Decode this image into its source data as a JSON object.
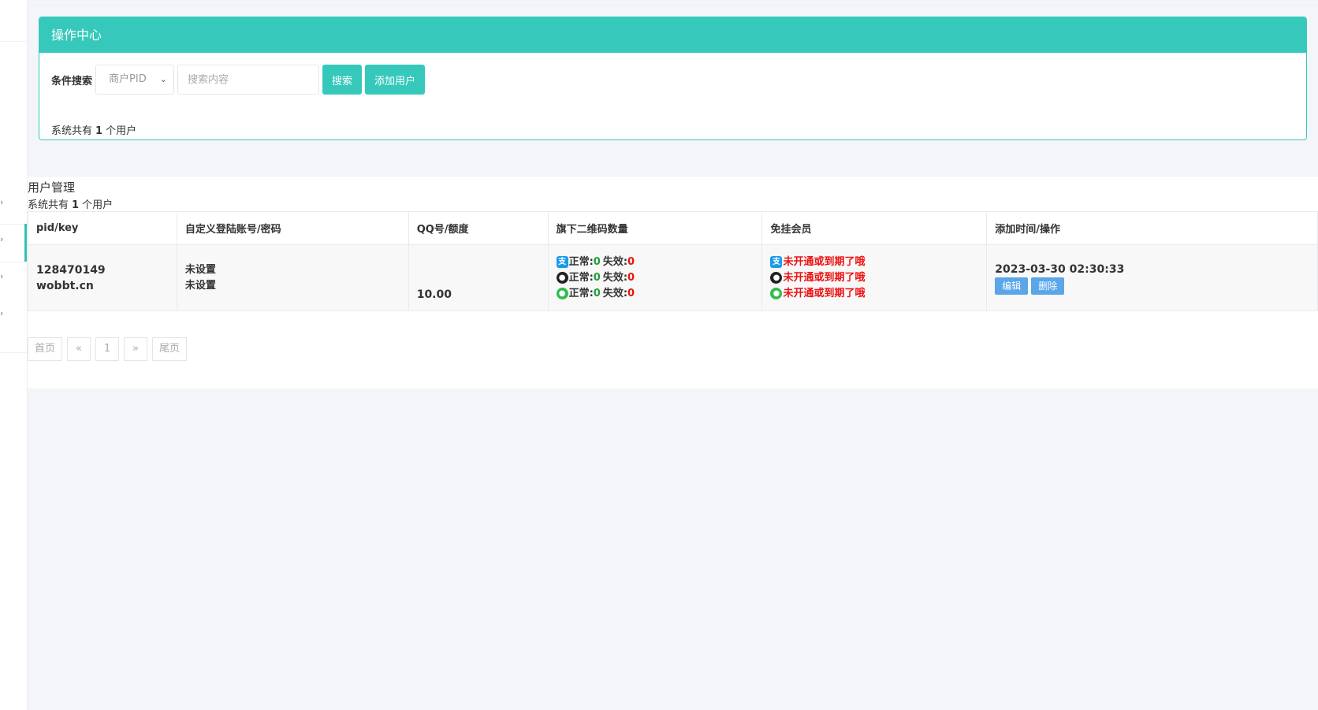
{
  "panel": {
    "title": "操作中心",
    "search_label": "条件搜索",
    "select_value": "商户PID",
    "search_placeholder": "搜索内容",
    "search_button": "搜索",
    "add_user_button": "添加用户",
    "count_prefix": "系统共有",
    "count_value": "1",
    "count_suffix": "个用户"
  },
  "mgmt": {
    "title": "用户管理",
    "count_prefix": "系统共有",
    "count_value": "1",
    "count_suffix": "个用户"
  },
  "table": {
    "headers": [
      "pid/key",
      "自定义登陆账号/密码",
      "QQ号/额度",
      "旗下二维码数量",
      "免挂会员",
      "添加时间/操作"
    ],
    "rows": [
      {
        "pid": "128470149",
        "key": "wobbt.cn",
        "login_account": "未设置",
        "login_password": "未设置",
        "quota": "10.00",
        "qrcodes": [
          {
            "icon": "alipay-icon",
            "ok_label": "正常:",
            "ok": "0",
            "bad_label": "失效:",
            "bad": "0"
          },
          {
            "icon": "qq-icon",
            "ok_label": "正常:",
            "ok": "0",
            "bad_label": "失效:",
            "bad": "0"
          },
          {
            "icon": "wechat-icon",
            "ok_label": "正常:",
            "ok": "0",
            "bad_label": "失效:",
            "bad": "0"
          }
        ],
        "members": [
          {
            "icon": "alipay-icon",
            "text": "未开通或到期了哦"
          },
          {
            "icon": "qq-icon",
            "text": "未开通或到期了哦"
          },
          {
            "icon": "wechat-icon",
            "text": "未开通或到期了哦"
          }
        ],
        "time": "2023-03-30 02:30:33",
        "edit": "编辑",
        "delete": "删除"
      }
    ]
  },
  "pager": {
    "first": "首页",
    "prev": "«",
    "page": "1",
    "next": "»",
    "last": "尾页"
  },
  "colors": {
    "accent": "#36c9bb",
    "ok": "#1e9e3a",
    "bad": "#ee1111",
    "action": "#5aa6e8"
  }
}
